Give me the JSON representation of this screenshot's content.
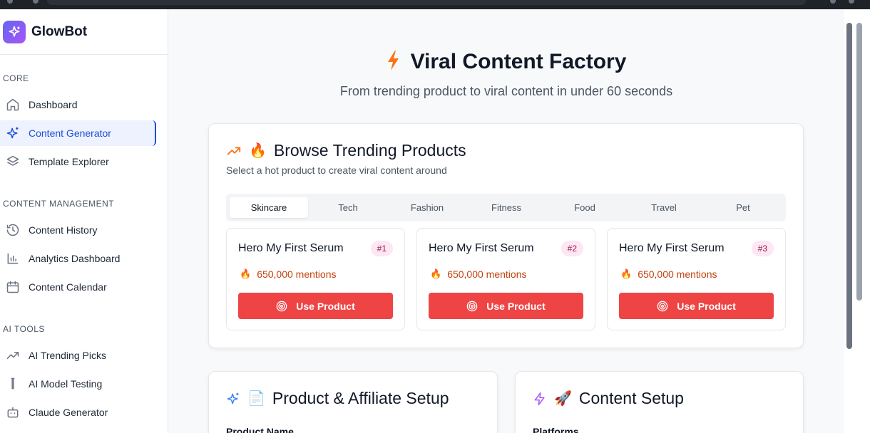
{
  "app": {
    "name": "GlowBot"
  },
  "sidebar": {
    "sections": [
      {
        "label": "CORE"
      },
      {
        "label": "CONTENT MANAGEMENT"
      },
      {
        "label": "AI TOOLS"
      }
    ],
    "items": [
      {
        "label": "Dashboard",
        "icon": "home-icon"
      },
      {
        "label": "Content Generator",
        "icon": "sparkles-icon",
        "active": true
      },
      {
        "label": "Template Explorer",
        "icon": "layers-icon"
      },
      {
        "label": "Content History",
        "icon": "history-icon"
      },
      {
        "label": "Analytics Dashboard",
        "icon": "bar-chart-icon"
      },
      {
        "label": "Content Calendar",
        "icon": "calendar-icon"
      },
      {
        "label": "AI Trending Picks",
        "icon": "trending-up-icon"
      },
      {
        "label": "AI Model Testing",
        "icon": "test-tube-icon"
      },
      {
        "label": "Claude Generator",
        "icon": "bot-icon"
      }
    ]
  },
  "hero": {
    "title": "Viral Content Factory",
    "subtitle": "From trending product to viral content in under 60 seconds"
  },
  "trending": {
    "title": "Browse Trending Products",
    "emoji": "🔥",
    "subtitle": "Select a hot product to create viral content around",
    "tabs": [
      "Skincare",
      "Tech",
      "Fashion",
      "Fitness",
      "Food",
      "Travel",
      "Pet"
    ],
    "active_tab": "Skincare",
    "products": [
      {
        "name": "Hero My First Serum",
        "rank": "#1",
        "mentions": "650,000 mentions",
        "button": "Use Product"
      },
      {
        "name": "Hero My First Serum",
        "rank": "#2",
        "mentions": "650,000 mentions",
        "button": "Use Product"
      },
      {
        "name": "Hero My First Serum",
        "rank": "#3",
        "mentions": "650,000 mentions",
        "button": "Use Product"
      }
    ]
  },
  "affiliate": {
    "title": "Product & Affiliate Setup",
    "emoji": "📄",
    "field_label": "Product Name"
  },
  "content_setup": {
    "title": "Content Setup",
    "emoji": "🚀",
    "field_label": "Platforms"
  },
  "colors": {
    "accent": "#1d4ed8",
    "button": "#ef4444",
    "badge_bg": "#fce7f3",
    "mentions": "#c2410c"
  }
}
